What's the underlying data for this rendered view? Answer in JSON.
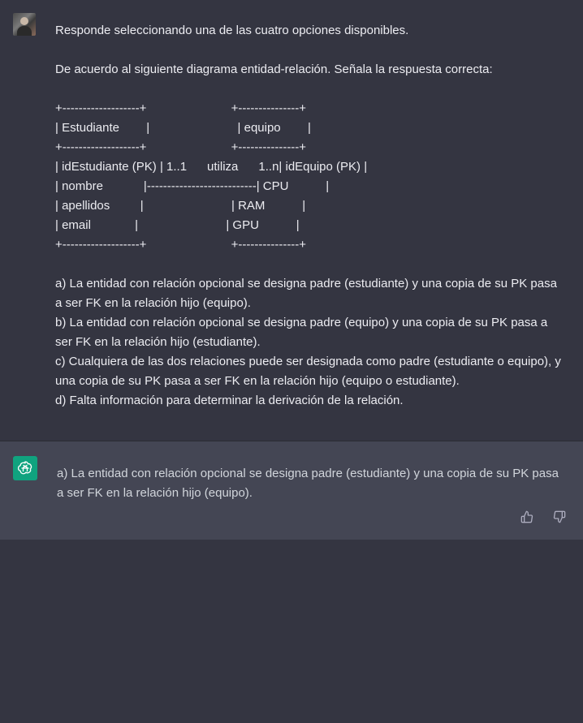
{
  "user_message": {
    "intro": "Responde seleccionando una de las cuatro opciones disponibles.",
    "question": "De acuerdo al siguiente diagrama entidad-relación. Señala la respuesta correcta:",
    "diagram_lines": [
      "+-------------------+                         +---------------+",
      "| Estudiante        |                          | equipo        |",
      "+-------------------+                         +---------------+",
      "| idEstudiante (PK) | 1..1      utiliza      1..n| idEquipo (PK) |",
      "| nombre            |---------------------------| CPU           |",
      "| apellidos         |                          | RAM           |",
      "| email             |                          | GPU           |",
      "+-------------------+                         +---------------+"
    ],
    "options": [
      "a) La entidad con relación opcional se designa padre (estudiante) y una copia de su PK pasa a ser FK en la relación hijo (equipo).",
      "b) La entidad con relación opcional se designa padre (equipo) y una copia de su PK pasa a ser FK en la relación hijo (estudiante).",
      "c) Cualquiera de las dos relaciones puede ser designada como padre (estudiante o equipo), y una copia de su PK pasa a ser FK en la relación hijo (equipo o estudiante).",
      "d) Falta información para determinar la derivación de la relación."
    ]
  },
  "assistant_message": {
    "text": "a) La entidad con relación opcional se designa padre (estudiante) y una copia de su PK pasa a ser FK en la relación hijo (equipo)."
  },
  "icons": {
    "user_avatar": "user-avatar",
    "bot_avatar": "openai-logo-icon",
    "thumbs_up": "thumbs-up-icon",
    "thumbs_down": "thumbs-down-icon"
  },
  "colors": {
    "background": "#343541",
    "assistant_background": "#444654",
    "accent": "#10a37f"
  }
}
